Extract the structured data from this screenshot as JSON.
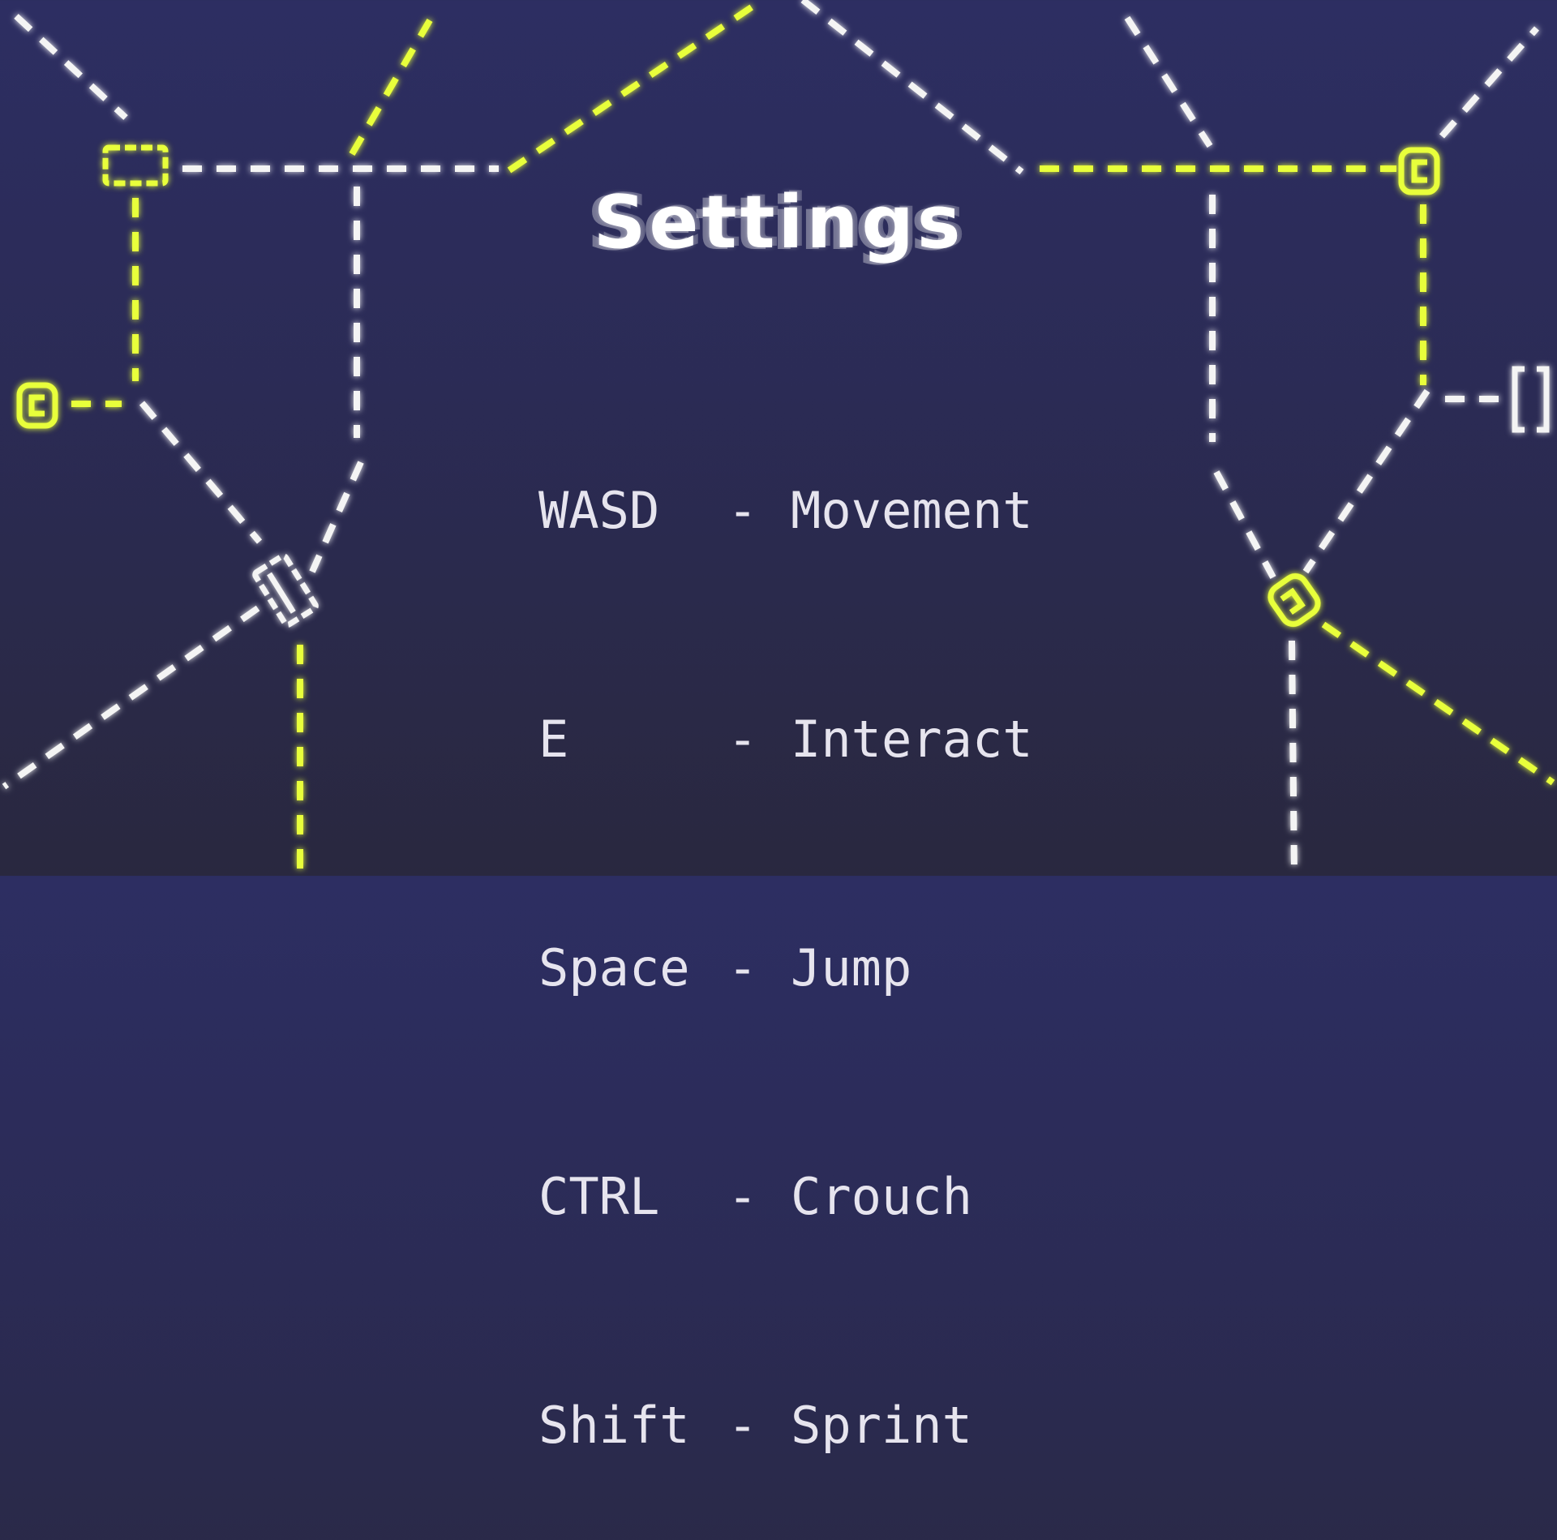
{
  "title": "Settings",
  "controls": [
    {
      "key": "WASD",
      "separator": "-",
      "action": "Movement"
    },
    {
      "key": "E",
      "separator": "-",
      "action": "Interact"
    },
    {
      "key": "Space",
      "separator": "-",
      "action": "Jump"
    },
    {
      "key": "CTRL",
      "separator": "-",
      "action": "Crouch"
    },
    {
      "key": "Shift",
      "separator": "-",
      "action": "Sprint"
    }
  ],
  "colors": {
    "background_top": "#2d2e62",
    "background_bottom": "#29283f",
    "wire_white": "#f4f4f4",
    "wire_yellow": "#e8ff3a",
    "text": "#e6e4ee"
  }
}
